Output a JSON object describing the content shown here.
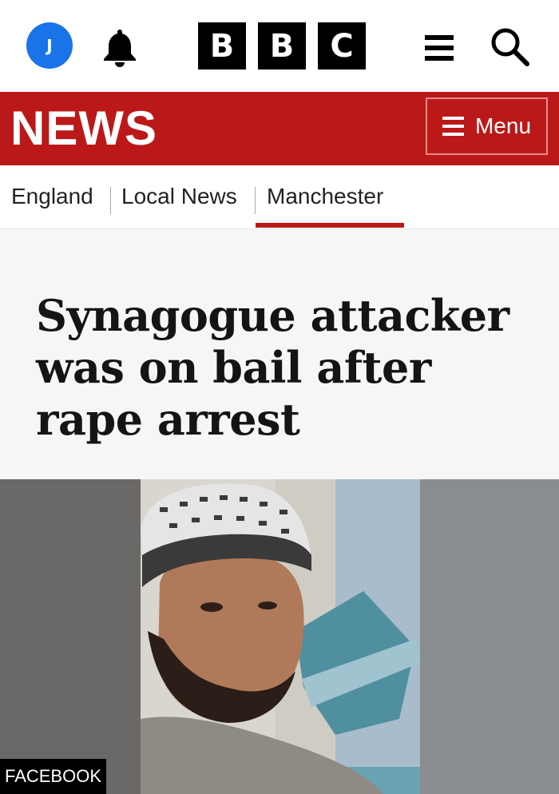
{
  "header": {
    "avatar_initial": "J",
    "logo_letters": [
      "B",
      "B",
      "C"
    ],
    "icons": {
      "notifications": "bell-icon",
      "menu": "hamburger-icon",
      "search": "search-icon"
    }
  },
  "news_bar": {
    "title": "NEWS",
    "menu_label": "Menu",
    "color": "#bb1919"
  },
  "breadcrumb": {
    "items": [
      "England",
      "Local News",
      "Manchester"
    ],
    "active": "Manchester"
  },
  "article": {
    "headline": "Synagogue attacker was on bail after rape arrest",
    "image_credit": "FACEBOOK"
  }
}
